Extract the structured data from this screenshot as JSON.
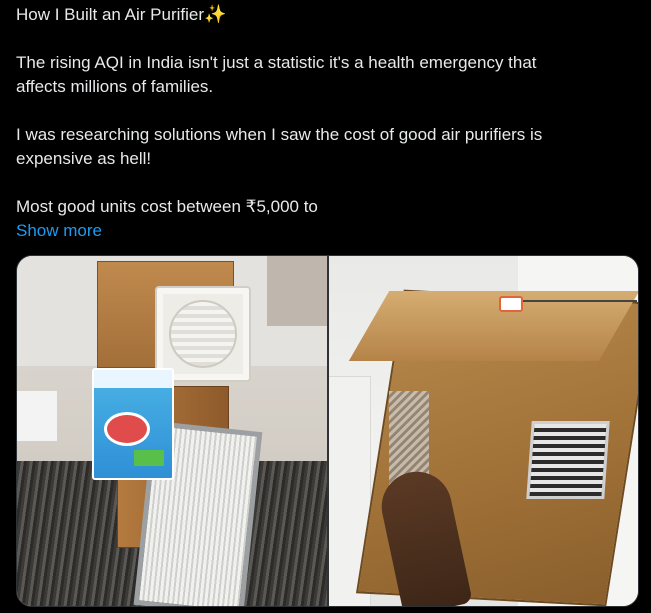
{
  "post": {
    "title": "How I Built an Air Purifier",
    "title_emoji": "✨",
    "para1_line1": "The rising AQI in India isn't just a statistic it's a health emergency that",
    "para1_line2": "affects millions of families.",
    "para2_line1": "I was researching solutions when I saw the cost of good air purifiers is",
    "para2_line2": "expensive as hell!",
    "para3_line1": "Most good units cost between ₹5,000 to",
    "show_more": "Show more"
  },
  "colors": {
    "background": "#000000",
    "text": "#e7e9ea",
    "link": "#1d9bf0",
    "border": "#2f3336"
  },
  "media": {
    "count": 2,
    "images": [
      {
        "alt_icon": "photo-purifier-parts"
      },
      {
        "alt_icon": "photo-cardboard-box-purifier"
      }
    ]
  }
}
